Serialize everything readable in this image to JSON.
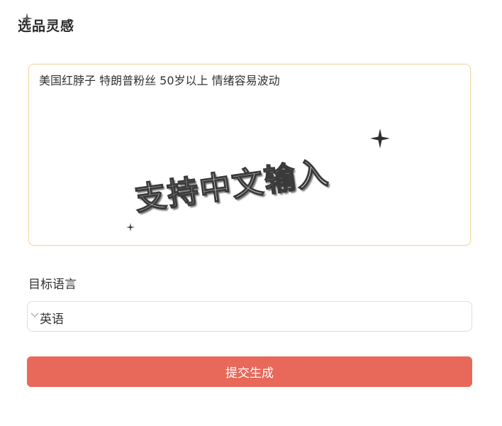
{
  "section": {
    "title": "选品灵感"
  },
  "inspiration": {
    "value": "美国红脖子 特朗普粉丝 50岁以上 情绪容易波动",
    "overlay_caption": "支持中文输入"
  },
  "target_language": {
    "label": "目标语言",
    "selected": "英语"
  },
  "submit": {
    "label": "提交生成"
  },
  "colors": {
    "accent_button": "#e8685a",
    "input_focus_border": "#f3d6a6",
    "select_border": "#dddddd"
  },
  "icons": {
    "select": "chevron-down-icon",
    "decoration": "sparkle-icon"
  }
}
